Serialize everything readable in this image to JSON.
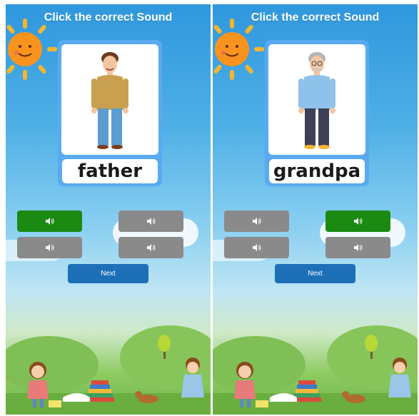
{
  "screens": [
    {
      "title": "Click the correct Sound",
      "word": "father",
      "picture": "father-illustration",
      "sound_buttons": [
        {
          "icon": "speaker-icon",
          "selected": true
        },
        {
          "icon": "speaker-icon",
          "selected": false
        },
        {
          "icon": "speaker-icon",
          "selected": false
        },
        {
          "icon": "speaker-icon",
          "selected": false
        }
      ],
      "next_label": "Next"
    },
    {
      "title": "Click the correct Sound",
      "word": "grandpa",
      "picture": "grandpa-illustration",
      "sound_buttons": [
        {
          "icon": "speaker-icon",
          "selected": false
        },
        {
          "icon": "speaker-icon",
          "selected": true
        },
        {
          "icon": "speaker-icon",
          "selected": false
        },
        {
          "icon": "speaker-icon",
          "selected": false
        }
      ],
      "next_label": "Next"
    }
  ],
  "colors": {
    "selected_button": "#1a8a12",
    "default_button": "#8a8a8a",
    "next_button": "#1d6fb8",
    "card_border": "#59aaf1"
  }
}
